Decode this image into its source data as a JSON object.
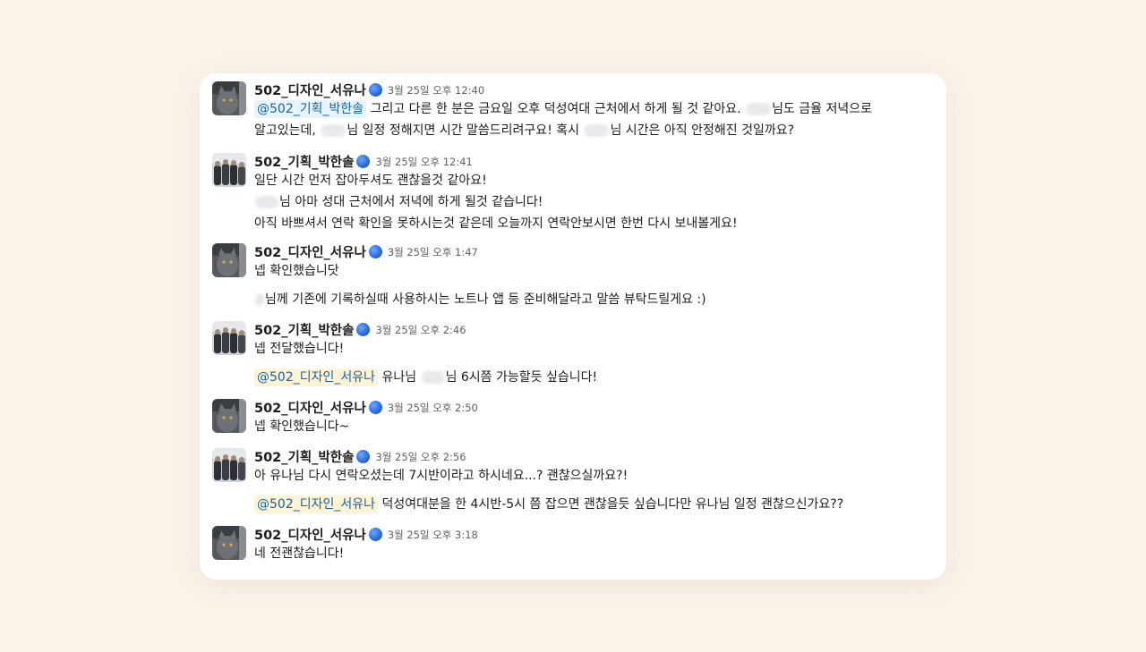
{
  "messages": [
    {
      "author": "502_디자인_서유나",
      "time": "3월 25일 오후 12:40",
      "lines": [
        {
          "mention": "@502_기획_박한솔",
          "text": "그리고 다른 한 분은 금요일 오후 덕성여대 근처에서 하게 될 것 같아요.",
          "text2": "님도 금율 저녁으로"
        },
        {
          "pre": "알고있는데,",
          "text": "님 일정 정해지면 시간 말씀드리려구요! 혹시",
          "text2": "님 시간은 아직 안정해진 것일까요?"
        }
      ]
    },
    {
      "author": "502_기획_박한솔",
      "time": "3월 25일 오후 12:41",
      "lines": [
        {
          "text": "일단 시간 먼저 잡아두셔도 괜찮을것 같아요!"
        },
        {
          "text": "님 아마 성대 근처에서 저녁에 하게 될것 같습니다!"
        },
        {
          "text": "아직 바쁘셔서 연락 확인을 못하시는것 같은데 오늘까지 연락안보시면 한번 다시 보내볼게요!"
        }
      ]
    },
    {
      "author": "502_디자인_서유나",
      "time": "3월 25일 오후 1:47",
      "lines": [
        {
          "text": "넵 확인했습니닷"
        },
        {
          "text": "님께 기존에 기록하실때 사용하시는 노트나 앱 등 준비해달라고 말씀 뷰탁드릴게요 :)"
        }
      ]
    },
    {
      "author": "502_기획_박한솔",
      "time": "3월 25일 오후 2:46",
      "lines": [
        {
          "text": "넵 전달했습니다!"
        },
        {
          "mention": "@502_디자인_서유나",
          "text": "유나님",
          "text2": "님 6시쯤 가능할듯 싶습니다!"
        }
      ]
    },
    {
      "author": "502_디자인_서유나",
      "time": "3월 25일 오후 2:50",
      "lines": [
        {
          "text": "넵 확인했습니다~"
        }
      ]
    },
    {
      "author": "502_기획_박한솔",
      "time": "3월 25일 오후 2:56",
      "lines": [
        {
          "text": "아 유나님 다시 연락오셨는데 7시반이라고 하시네요...? 괜찮으실까요?!"
        },
        {
          "mention": "@502_디자인_서유나",
          "text": "덕성여대분을 한 4시반-5시 쯤 잡으면 괜찮을듯 싶습니다만 유나님 일정 괜찮으신가요??"
        }
      ]
    },
    {
      "author": "502_디자인_서유나",
      "time": "3월 25일 오후 3:18",
      "lines": [
        {
          "text": "네 전괜찮습니다!"
        }
      ]
    }
  ],
  "icons": {
    "status": "blue-circle-icon",
    "avatar_designer": "cat-photo-avatar",
    "avatar_planner": "group-photo-avatar"
  },
  "colors": {
    "background": "#fbf3ea",
    "card": "#ffffff",
    "mention_text": "#1264a3",
    "mention_bg_yellow": "#fff3d6",
    "mention_bg_blue": "#e8f4fb"
  }
}
